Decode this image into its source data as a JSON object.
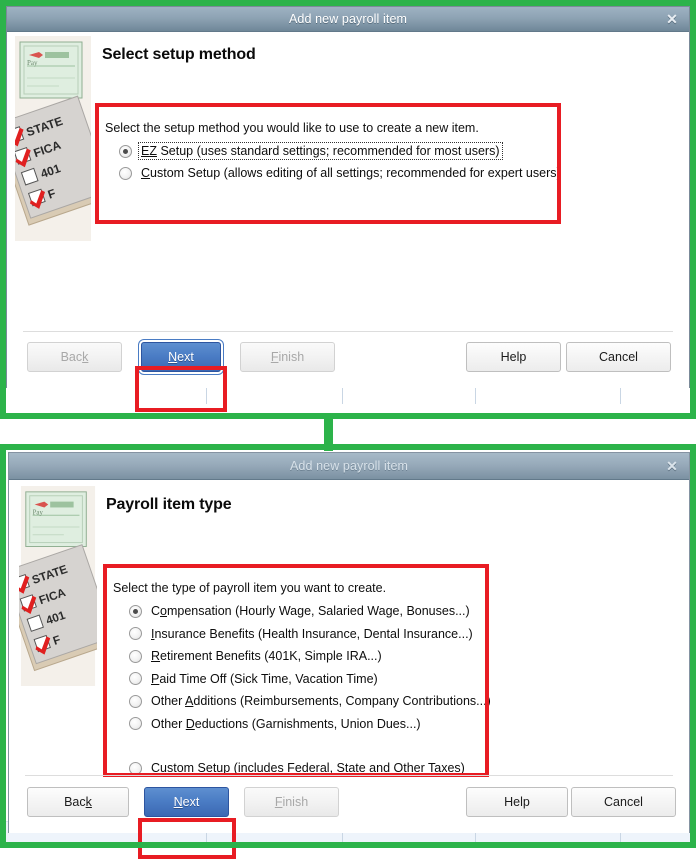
{
  "colors": {
    "highlight_green": "#2cb34a",
    "annotation_red": "#e81c23",
    "primary_button_blue": "#4a7cc4",
    "titlebar_blue_gray": "#8ea3b4"
  },
  "background_app": {
    "row_count": 9,
    "row_marker": "(",
    "row_tint": "#eef4fb"
  },
  "dialog_one": {
    "title": "Add new payroll item",
    "close_label": "✕",
    "heading": "Select setup method",
    "side_art_name": "paycheck-tax-checklist-illustration",
    "instruction": "Select the setup method you would like to use to create a new item.",
    "options": [
      {
        "accel": "EZ",
        "rest": " Setup (uses standard settings; recommended for most users)",
        "selected": true,
        "focused": true
      },
      {
        "accel": "C",
        "rest": "ustom Setup (allows editing of all settings; recommended for expert users)",
        "selected": false,
        "focused": false
      }
    ],
    "buttons": {
      "back": {
        "accel_pre": "Bac",
        "accel": "k",
        "accel_post": "",
        "state": "disabled"
      },
      "next": {
        "accel_pre": "",
        "accel": "N",
        "accel_post": "ext",
        "state": "primary-focused"
      },
      "finish": {
        "accel_pre": "",
        "accel": "F",
        "accel_post": "inish",
        "state": "disabled"
      },
      "help": {
        "accel_pre": "Help",
        "accel": "",
        "accel_post": "",
        "state": "enabled"
      },
      "cancel": {
        "accel_pre": "Cancel",
        "accel": "",
        "accel_post": "",
        "state": "enabled"
      }
    }
  },
  "dialog_two": {
    "title": "Add new payroll item",
    "close_label": "✕",
    "heading": "Payroll item type",
    "side_art_name": "paycheck-tax-checklist-illustration",
    "instruction": "Select the type of payroll item you want to create.",
    "options": [
      {
        "pre": "C",
        "accel": "o",
        "rest": "mpensation (Hourly Wage, Salaried Wage, Bonuses...)",
        "selected": true,
        "spaced": false
      },
      {
        "pre": "",
        "accel": "I",
        "rest": "nsurance Benefits (Health Insurance, Dental Insurance...)",
        "selected": false,
        "spaced": false
      },
      {
        "pre": "",
        "accel": "R",
        "rest": "etirement Benefits (401K, Simple IRA...)",
        "selected": false,
        "spaced": false
      },
      {
        "pre": "",
        "accel": "P",
        "rest": "aid Time Off (Sick Time, Vacation Time)",
        "selected": false,
        "spaced": false
      },
      {
        "pre": "Other ",
        "accel": "A",
        "rest": "dditions (Reimbursements, Company Contributions...)",
        "selected": false,
        "spaced": false
      },
      {
        "pre": "Other ",
        "accel": "D",
        "rest": "eductions (Garnishments, Union Dues...)",
        "selected": false,
        "spaced": false
      },
      {
        "pre": "",
        "accel": "C",
        "rest": "ustom Setup (includes Federal, State and Other Taxes)",
        "selected": false,
        "spaced": true
      }
    ],
    "buttons": {
      "back": {
        "accel_pre": "Bac",
        "accel": "k",
        "accel_post": "",
        "state": "enabled"
      },
      "next": {
        "accel_pre": "",
        "accel": "N",
        "accel_post": "ext",
        "state": "primary"
      },
      "finish": {
        "accel_pre": "",
        "accel": "F",
        "accel_post": "inish",
        "state": "disabled"
      },
      "help": {
        "accel_pre": "Help",
        "accel": "",
        "accel_post": "",
        "state": "enabled"
      },
      "cancel": {
        "accel_pre": "Cancel",
        "accel": "",
        "accel_post": "",
        "state": "enabled"
      }
    }
  }
}
